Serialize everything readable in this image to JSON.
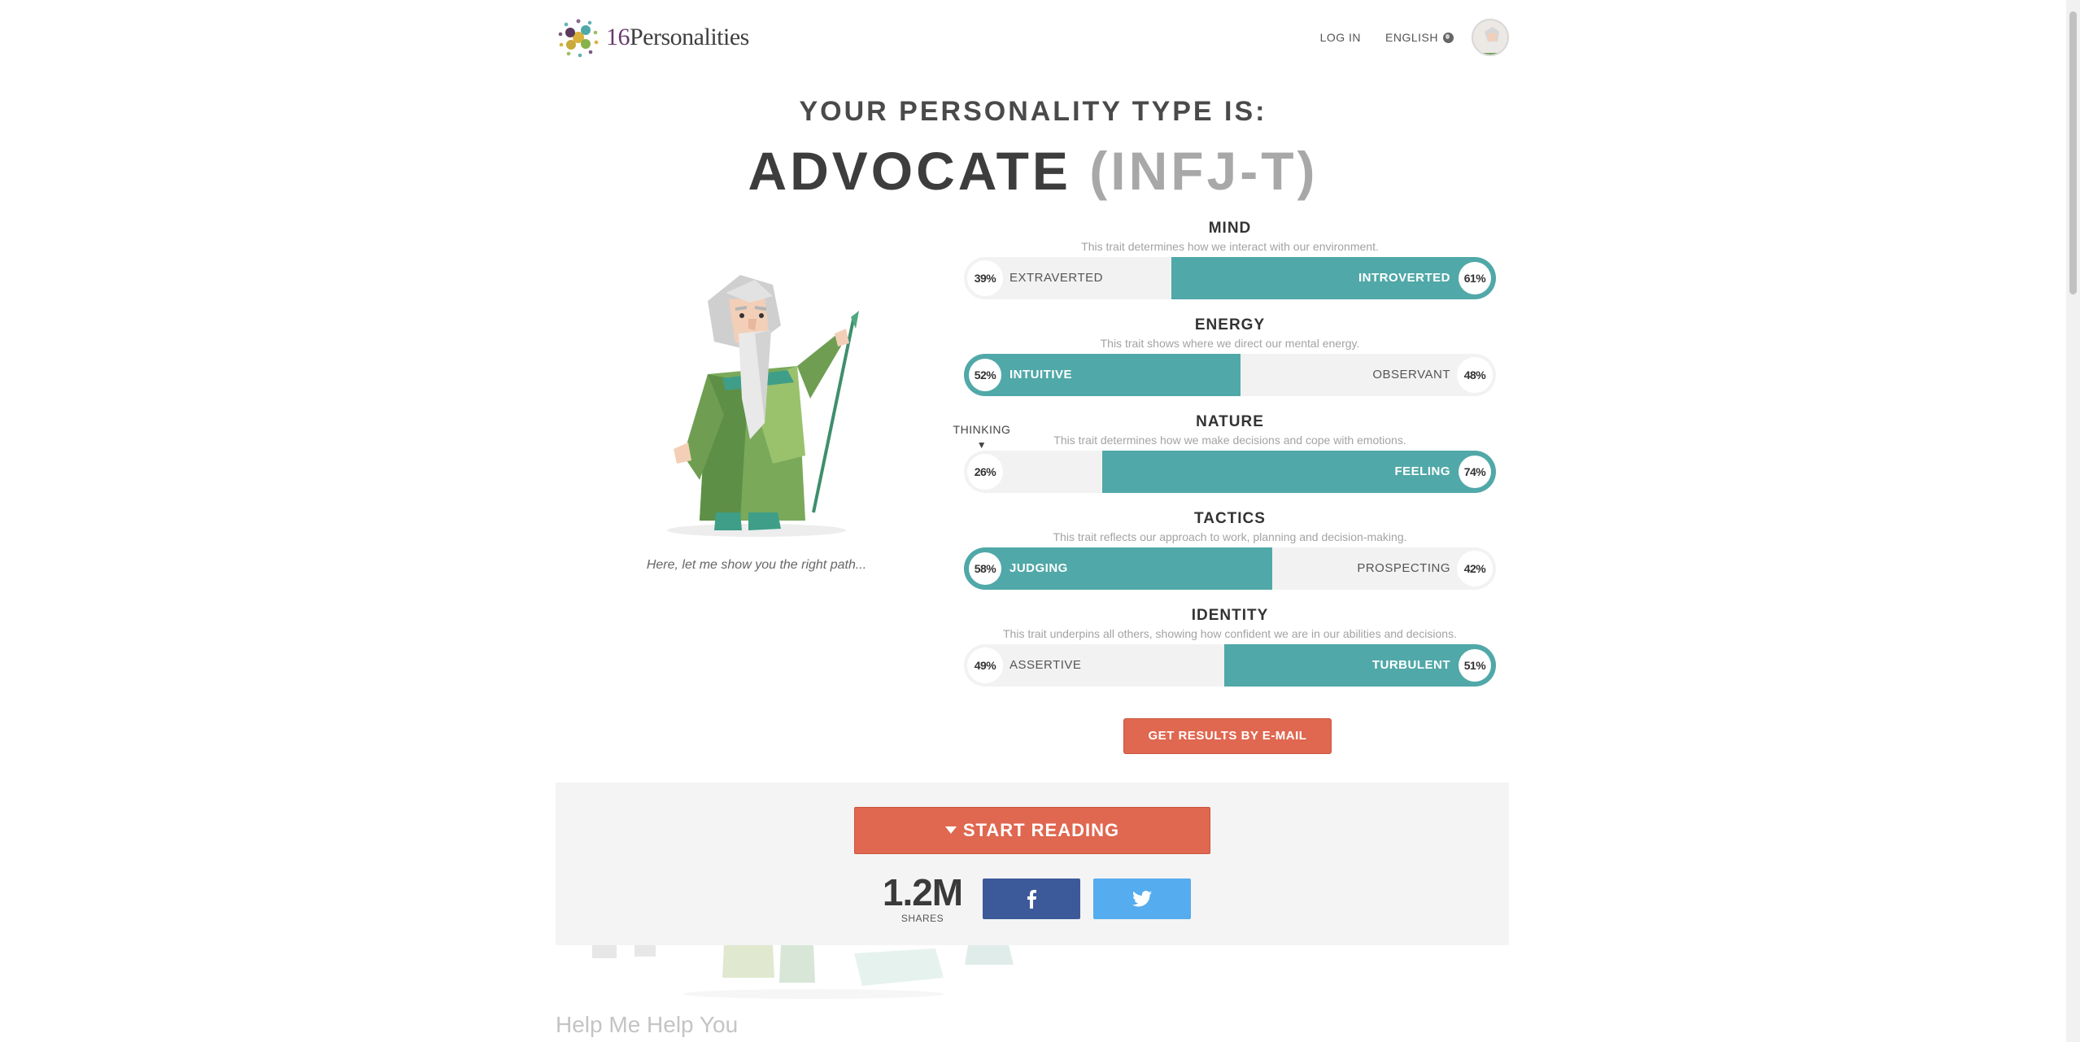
{
  "header": {
    "logo_number": "16",
    "logo_word": "Personalities",
    "login_label": "LOG IN",
    "language_label": "ENGLISH"
  },
  "result": {
    "subtitle": "YOUR PERSONALITY TYPE IS:",
    "type_name": "ADVOCATE",
    "type_code": "(INFJ-T)",
    "caption": "Here, let me show you the right path..."
  },
  "traits": [
    {
      "name": "MIND",
      "description": "This trait determines how we interact with our environment.",
      "left_label": "EXTRAVERTED",
      "left_pct": "39%",
      "right_label": "INTROVERTED",
      "right_pct": "61%",
      "dominant": "right",
      "fill_fraction": 0.61
    },
    {
      "name": "ENERGY",
      "description": "This trait shows where we direct our mental energy.",
      "left_label": "INTUITIVE",
      "left_pct": "52%",
      "right_label": "OBSERVANT",
      "right_pct": "48%",
      "dominant": "left",
      "fill_fraction": 0.52
    },
    {
      "name": "NATURE",
      "description": "This trait determines how we make decisions and cope with emotions.",
      "left_label": "",
      "left_pct": "26%",
      "right_label": "FEELING",
      "right_pct": "74%",
      "dominant": "right",
      "fill_fraction": 0.74
    },
    {
      "name": "TACTICS",
      "description": "This trait reflects our approach to work, planning and decision-making.",
      "left_label": "JUDGING",
      "left_pct": "58%",
      "right_label": "PROSPECTING",
      "right_pct": "42%",
      "dominant": "left",
      "fill_fraction": 0.58
    },
    {
      "name": "IDENTITY",
      "description": "This trait underpins all others, showing how confident we are in our abilities and decisions.",
      "left_label": "ASSERTIVE",
      "left_pct": "49%",
      "right_label": "TURBULENT",
      "right_pct": "51%",
      "dominant": "right",
      "fill_fraction": 0.51
    }
  ],
  "nature_hover_label": "THINKING",
  "email_button": "GET RESULTS BY E-MAIL",
  "reading": {
    "start_label": "START READING",
    "shares_count": "1.2M",
    "shares_label": "SHARES"
  },
  "help_title": "Help Me Help You",
  "colors": {
    "accent_teal": "#51a8a8",
    "button_red": "#e06750",
    "facebook_blue": "#3c5a9a",
    "twitter_blue": "#55acee"
  },
  "icons": [
    "logo-dots-icon",
    "globe-icon",
    "caret-down-icon",
    "facebook-icon",
    "twitter-icon"
  ]
}
